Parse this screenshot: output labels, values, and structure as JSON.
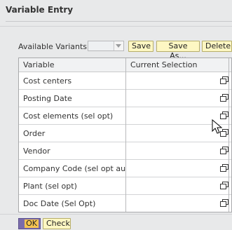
{
  "dialog": {
    "title": "Variable Entry"
  },
  "variants": {
    "label": "Available Variants:",
    "selected": "",
    "buttons": {
      "save": "Save",
      "save_as": "Save As...",
      "delete": "Delete"
    }
  },
  "table": {
    "columns": [
      "Variable",
      "Current Selection"
    ],
    "rows": [
      {
        "variable": "Cost centers",
        "selection": ""
      },
      {
        "variable": "Posting Date",
        "selection": ""
      },
      {
        "variable": "Cost elements (sel opt)",
        "selection": ""
      },
      {
        "variable": "Order",
        "selection": ""
      },
      {
        "variable": "Vendor",
        "selection": ""
      },
      {
        "variable": "Company Code (sel opt auth)",
        "selection": ""
      },
      {
        "variable": "Plant (sel opt)",
        "selection": ""
      },
      {
        "variable": "Doc Date (Sel Opt)",
        "selection": ""
      }
    ]
  },
  "footer": {
    "ok": "OK",
    "check": "Check"
  },
  "icons": {
    "value_help": "value-help-icon",
    "mouse": "mouse-pointer-icon"
  },
  "colors": {
    "button_bg": "#fdf7c3",
    "ok_bg": "#f5c451",
    "ok_border": "#7a6cab",
    "dialog_bg": "#e8e9ea"
  }
}
